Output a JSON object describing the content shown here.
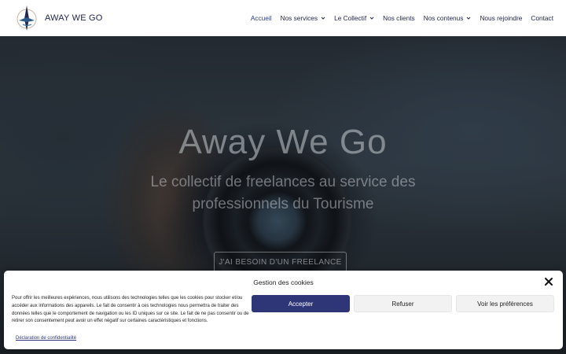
{
  "header": {
    "logo_text": "AWAY WE GO",
    "nav": [
      {
        "label": "Accueil",
        "active": true,
        "dropdown": false
      },
      {
        "label": "Nos services",
        "active": false,
        "dropdown": true
      },
      {
        "label": "Le Collectif",
        "active": false,
        "dropdown": true
      },
      {
        "label": "Nos clients",
        "active": false,
        "dropdown": false
      },
      {
        "label": "Nos contenus",
        "active": false,
        "dropdown": true
      },
      {
        "label": "Nous rejoindre",
        "active": false,
        "dropdown": false
      },
      {
        "label": "Contact",
        "active": false,
        "dropdown": false
      }
    ]
  },
  "hero": {
    "title": "Away We Go",
    "subtitle": "Le collectif de freelances au service des professionnels du Tourisme",
    "cta_label": "J'AI BESOIN D'UN FREELANCE"
  },
  "cookie": {
    "title": "Gestion des cookies",
    "text": "Pour offrir les meilleures expériences, nous utilisons des technologies telles que les cookies pour stocker et/ou accéder aux informations des appareils. Le fait de consentir à ces technologies nous permettra de traiter des données telles que le comportement de navigation ou les ID uniques sur ce site. Le fait de ne pas consentir ou de retirer son consentement peut avoir un effet négatif sur certaines caractéristiques et fonctions.",
    "accept_label": "Accepter",
    "refuse_label": "Refuser",
    "prefs_label": "Voir les préférences",
    "privacy_link": "Déclaration de confidentialité"
  },
  "colors": {
    "brand_navy": "#2e3678",
    "nav_text": "#1f2346"
  },
  "icons": [
    "logo-compass-icon",
    "chevron-down-icon",
    "close-icon"
  ]
}
